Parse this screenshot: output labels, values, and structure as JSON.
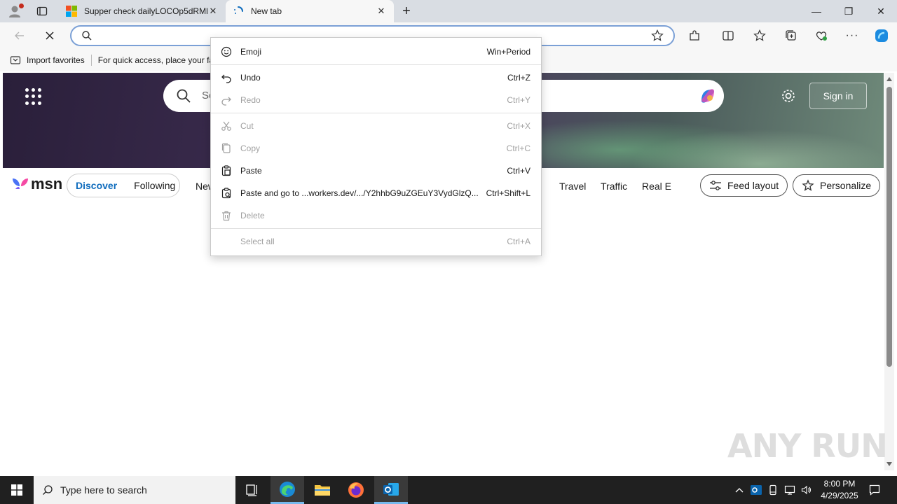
{
  "browser": {
    "tabs": [
      {
        "title": "Supper check dailyLOCOp5dRMl",
        "active": false
      },
      {
        "title": "New tab",
        "active": true
      }
    ],
    "address_value": "",
    "favorites_bar": {
      "import_label": "Import favorites",
      "hint": "For quick access, place your fa"
    }
  },
  "msn": {
    "search_placeholder": "Se",
    "sign_in": "Sign in",
    "logo_text": "msn",
    "tabs": {
      "discover": "Discover",
      "following": "Following"
    },
    "nav_links": [
      "New",
      "Travel",
      "Traffic",
      "Real E"
    ],
    "feed_layout": "Feed layout",
    "personalize": "Personalize"
  },
  "context_menu": [
    {
      "label": "Emoji",
      "shortcut": "Win+Period",
      "enabled": true,
      "icon": "emoji-icon"
    },
    {
      "label": "Undo",
      "shortcut": "Ctrl+Z",
      "enabled": true,
      "icon": "undo-icon"
    },
    {
      "label": "Redo",
      "shortcut": "Ctrl+Y",
      "enabled": false,
      "icon": "redo-icon"
    },
    {
      "label": "Cut",
      "shortcut": "Ctrl+X",
      "enabled": false,
      "icon": "cut-icon"
    },
    {
      "label": "Copy",
      "shortcut": "Ctrl+C",
      "enabled": false,
      "icon": "copy-icon"
    },
    {
      "label": "Paste",
      "shortcut": "Ctrl+V",
      "enabled": true,
      "icon": "paste-icon"
    },
    {
      "label": "Paste and go to ...workers.dev/.../Y2hhbG9uZGEuY3VydGlzQ...",
      "shortcut": "Ctrl+Shift+L",
      "enabled": true,
      "icon": "paste-go-icon"
    },
    {
      "label": "Delete",
      "shortcut": "",
      "enabled": false,
      "icon": "delete-icon"
    },
    {
      "label": "Select all",
      "shortcut": "Ctrl+A",
      "enabled": false,
      "icon": ""
    }
  ],
  "taskbar": {
    "search_placeholder": "Type here to search",
    "time": "8:00 PM",
    "date": "4/29/2025"
  },
  "watermark": "ANY RUN",
  "colors": {
    "accent": "#0f6cbd",
    "taskbar": "#202020",
    "tab_strip": "#d9dde3"
  }
}
